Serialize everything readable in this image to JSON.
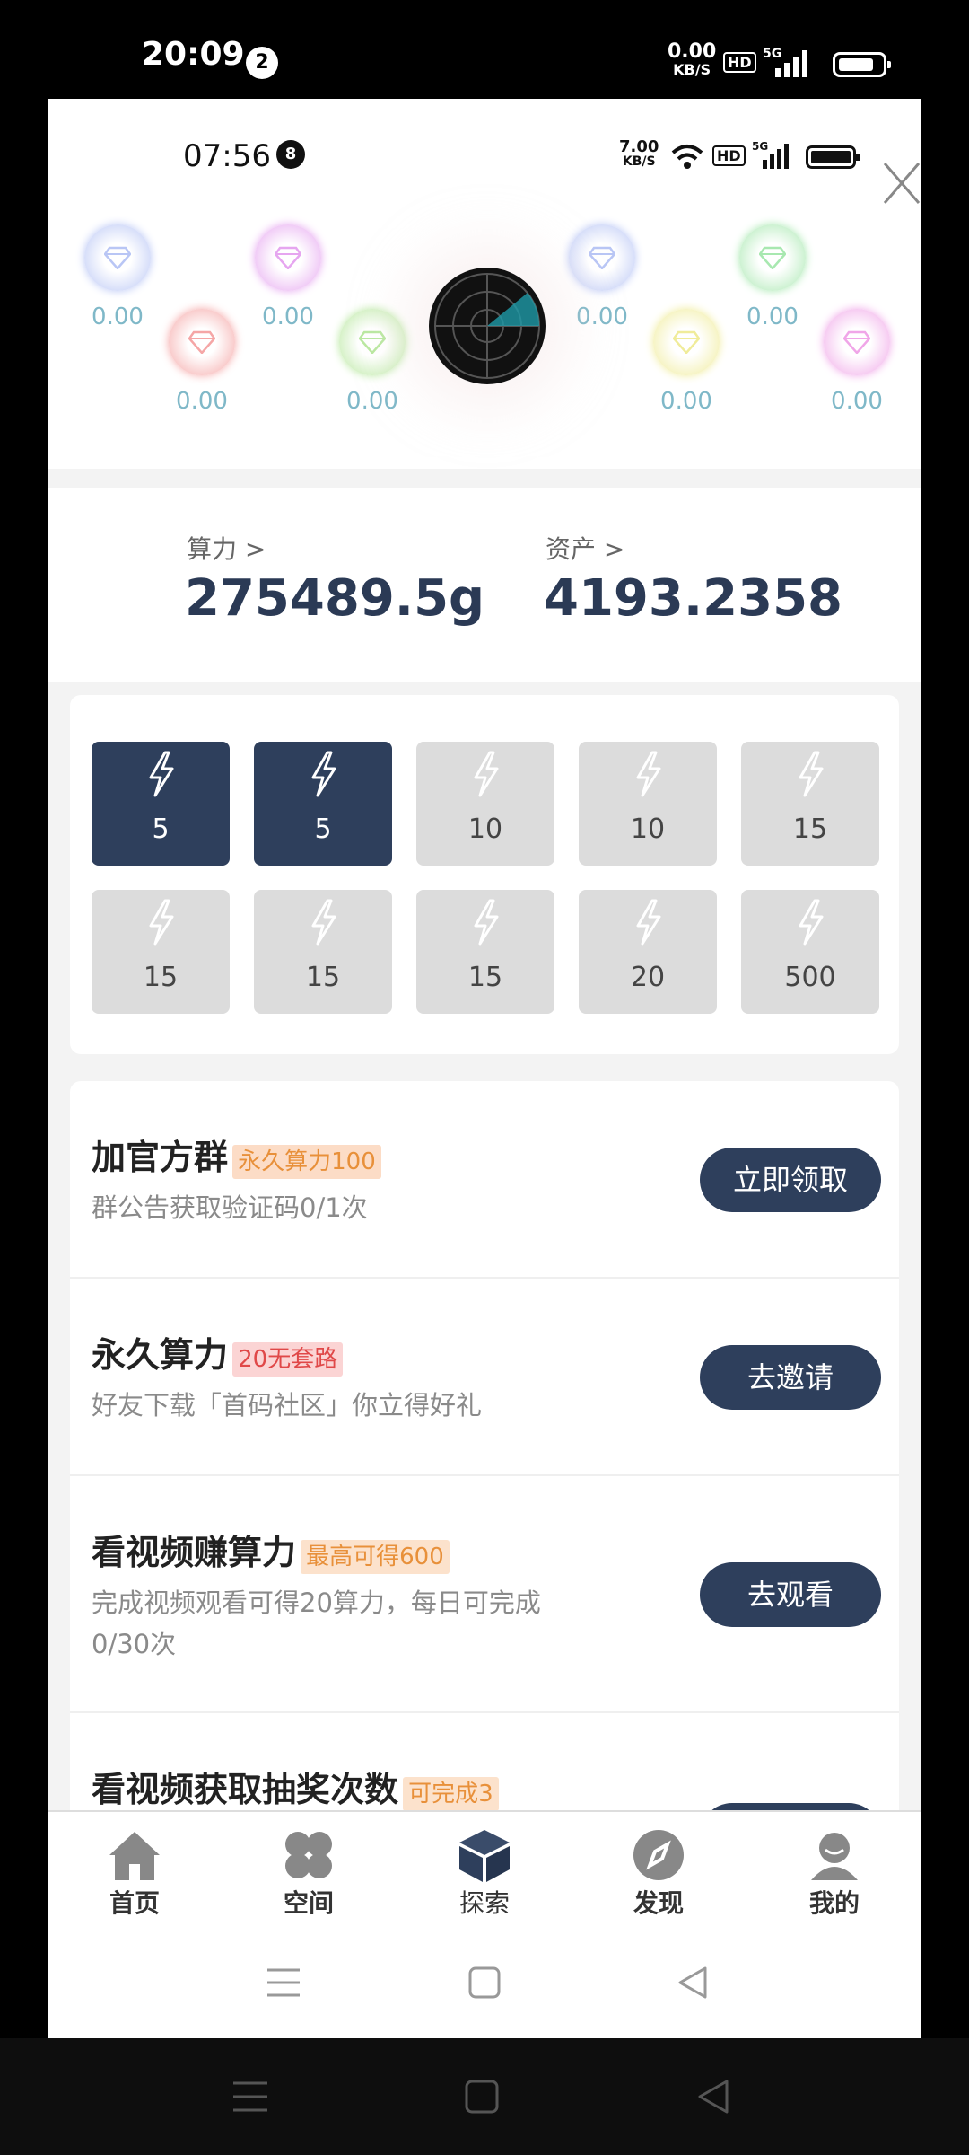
{
  "outer_status": {
    "time": "20:09",
    "notif_count": "2",
    "net_speed": "0.00",
    "net_unit": "KB/S",
    "hd": "HD",
    "signal": "5G"
  },
  "inner_status": {
    "time": "07:56",
    "notif_count": "8",
    "net_speed": "7.00",
    "net_unit": "KB/S",
    "hd": "HD",
    "signal": "5G"
  },
  "gems": [
    {
      "value": "0.00",
      "color": "#b9c6f5"
    },
    {
      "value": "0.00",
      "color": "#f5a6a6"
    },
    {
      "value": "0.00",
      "color": "#e6a6f0"
    },
    {
      "value": "0.00",
      "color": "#b9e8a0"
    },
    {
      "value": "0.00",
      "color": "#b9c6f5"
    },
    {
      "value": "0.00",
      "color": "#f0ec9a"
    },
    {
      "value": "0.00",
      "color": "#a8e8b0"
    },
    {
      "value": "0.00",
      "color": "#f0a6e8"
    }
  ],
  "stats": {
    "power_label": "算力 >",
    "power_value": "275489.5g",
    "assets_label": "资产 >",
    "assets_value": "4193.2358"
  },
  "boosts": [
    {
      "value": "5",
      "active": true
    },
    {
      "value": "5",
      "active": true
    },
    {
      "value": "10",
      "active": false
    },
    {
      "value": "10",
      "active": false
    },
    {
      "value": "15",
      "active": false
    },
    {
      "value": "15",
      "active": false
    },
    {
      "value": "15",
      "active": false
    },
    {
      "value": "15",
      "active": false
    },
    {
      "value": "20",
      "active": false
    },
    {
      "value": "500",
      "active": false
    }
  ],
  "tasks": [
    {
      "title": "加官方群",
      "tag": "永久算力100",
      "tag_color": "#e8903a",
      "tag_bg": "#fcdcc6",
      "desc": "群公告获取验证码0/1次",
      "button": "立即领取"
    },
    {
      "title": "永久算力",
      "tag": "20无套路",
      "tag_color": "#e04848",
      "tag_bg": "#fbd4d4",
      "desc": "好友下载「首码社区」你立得好礼",
      "button": "去邀请"
    },
    {
      "title": "看视频赚算力",
      "tag": "最高可得600",
      "tag_color": "#e8903a",
      "tag_bg": "#fce2cc",
      "desc1": "完成视频观看可得20算力，每日可完成",
      "desc2": "0/30次",
      "button": "去观看"
    },
    {
      "title": "看视频获取抽奖次数",
      "tag": "可完成3",
      "tag_color": "#e8903a",
      "tag_bg": "#fce2cc"
    }
  ],
  "nav": [
    {
      "label": "首页",
      "icon": "home-icon"
    },
    {
      "label": "空间",
      "icon": "clover-icon"
    },
    {
      "label": "探索",
      "icon": "cube-icon"
    },
    {
      "label": "发现",
      "icon": "compass-icon"
    },
    {
      "label": "我的",
      "icon": "user-icon"
    }
  ]
}
